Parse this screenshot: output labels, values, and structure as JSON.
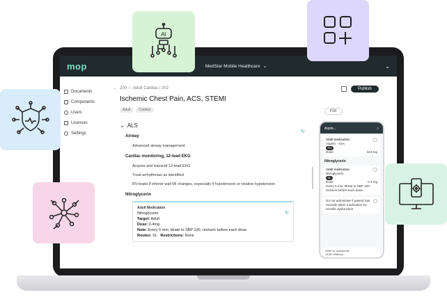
{
  "app": {
    "logo": "mop",
    "org_name": "MedStar Mobile Healthcare"
  },
  "sidebar": {
    "items": [
      {
        "label": "Documents"
      },
      {
        "label": "Components"
      },
      {
        "label": "Users"
      },
      {
        "label": "Licenses"
      },
      {
        "label": "Settings"
      }
    ]
  },
  "doc": {
    "breadcrumb": "200 — Adult Cardiac / 202",
    "title": "Ischemic Chest Pain, ACS, STEMI",
    "tags": [
      "Adult",
      "Cardiac"
    ],
    "publish_label": "Publish",
    "pdf_label": "PDF",
    "section_label": "ALS",
    "airway_heading": "Airway",
    "airway_line": "Advanced airway management",
    "cardiac_heading": "Cardiac monitoring, 12-lead EKG",
    "cardiac_lines": [
      "Acquire and transmit 12-lead EKG",
      "Treat arrhythmias as identified",
      "RV-leads if inferior wall MI changes, especially if hypotension or relative hypotension"
    ],
    "nitro_heading": "Nitroglycerin",
    "card": {
      "header": "Adult Medication",
      "name": "Nitroglycerin",
      "target_label": "Target:",
      "target_value": "Adult",
      "dose_label": "Dose:",
      "dose_value": "0.4mg",
      "note_label": "Note:",
      "note_value": "Every 5 min, titrate to SBP 100, recheck before each dose.",
      "routes_label": "Routes:",
      "routes_value": "SL",
      "restrictions_label": "Restrictions:",
      "restrictions_value": "None"
    }
  },
  "phone": {
    "header": "Aspin...",
    "card1": {
      "header": "Adult medication",
      "name": "Aspirin - ASA",
      "pill": "PO",
      "dose_label": "Dose",
      "dose_value": "324 mg"
    },
    "group2": "Nitroglycerin",
    "card2": {
      "header": "Adult medication",
      "name": "Nitroglycerin",
      "pill": "SL",
      "dose_label": "Dose",
      "dose_value": "0.4 mg",
      "note": "Every 5 min, titrate to SBP 100, recheck before each dose."
    },
    "card3": {
      "note": "Do not administer if patient has recently taken medication for erectile dysfunction"
    },
    "footer": "Refer to documents",
    "footer2": "1428: Whitney..."
  },
  "tiles": {
    "ai_label": "AI"
  },
  "colors": {
    "tile_blue": "#d9ecf9",
    "tile_green": "#d7f3d6",
    "tile_purple": "#dcd7fb",
    "tile_pink": "#f7d6e7",
    "tile_mint": "#d8f3e6",
    "brand": "#7be0c0"
  }
}
